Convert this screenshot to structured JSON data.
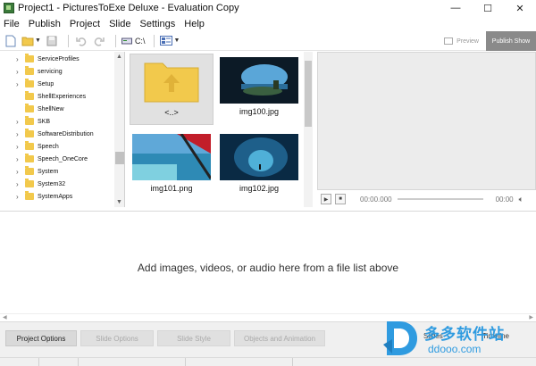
{
  "window": {
    "title": "Project1 - PicturesToExe Deluxe - Evaluation Copy",
    "controls": [
      "—",
      "☐",
      "✕"
    ]
  },
  "menu": [
    "File",
    "Publish",
    "Project",
    "Slide",
    "Settings",
    "Help"
  ],
  "toolbar": {
    "path_label": "C:\\",
    "preview_label": "Preview",
    "publish_show_label": "Publish Show",
    "icons": [
      "new-file-icon",
      "open-folder-icon",
      "save-icon",
      "undo-icon",
      "redo-icon",
      "drive-icon",
      "view-mode-icon"
    ]
  },
  "folders": [
    "ServiceProfiles",
    "servicing",
    "Setup",
    "ShellExperiences",
    "ShellNew",
    "SKB",
    "SoftwareDistribution",
    "Speech",
    "Speech_OneCore",
    "System",
    "System32",
    "SystemApps"
  ],
  "files": [
    {
      "name": "<..>",
      "kind": "parent-folder"
    },
    {
      "name": "img100.jpg",
      "kind": "image"
    },
    {
      "name": "img101.png",
      "kind": "image"
    },
    {
      "name": "img102.jpg",
      "kind": "image"
    }
  ],
  "player": {
    "play_icon": "play-icon",
    "stop_icon": "stop-icon",
    "current_time": "00:00.000",
    "end_time": "00:00",
    "volume_icon": "volume-icon"
  },
  "timeline": {
    "hint": "Add images, videos, or audio here from a file list above"
  },
  "bottom": {
    "project_options": "Project Options",
    "slide_options": "Slide Options",
    "slide_style": "Slide Style",
    "objects_animation": "Objects and Animation",
    "tab_slides": "Slides",
    "tab_timeline": "Timeline"
  },
  "watermark": {
    "text_cn": "多多软件站",
    "url": "ddooo.com"
  },
  "colors": {
    "publish_bg": "#8a8a8a",
    "folder": "#f2c94c",
    "watermark": "#2f9be0"
  }
}
